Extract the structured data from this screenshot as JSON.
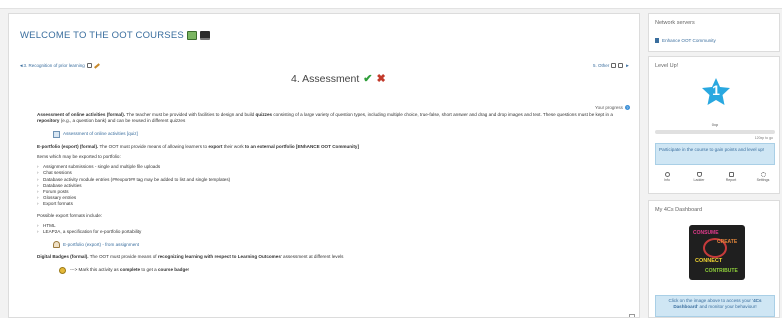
{
  "course": {
    "title": "WELCOME TO THE OOT COURSES",
    "icons": [
      "book-icon",
      "laptop-icon"
    ]
  },
  "section_nav": {
    "prev": "◄3. Recognition of prior learning",
    "next": "5. Other"
  },
  "section": {
    "title": "4. Assessment",
    "progress_label": "Your progress"
  },
  "content": {
    "p1_bold": "Assessment of online activities (formal).",
    "p1_a": " The teacher must be provided with facilities to design and build ",
    "p1_b": "quizzes",
    "p1_c": " consisting of a large variety of question types, including multiple choice, true-false, short answer and drag and drop images and text. These questions must be kept in a ",
    "p1_d": "repository",
    "p1_e": " (e.g., a question bank) and can be reused in different quizzes",
    "quiz_link": "Assessment of online activities [quiz]",
    "p2_bold": "E-portfolio (export) (formal).",
    "p2_a": " The OOT must provide means of allowing learners to ",
    "p2_b": "export",
    "p2_c": " their work ",
    "p2_d": "to an external portfolio [ENhANCE OOT Community]",
    "items_intro": "Items which may be exported to portfolio:",
    "export_items": [
      "Assignment submissions - single and multiple file uploads",
      "Chat sessions",
      "Database activity module entries (##export## tag may be added to list and single templates)",
      "Database activities",
      "Forum posts",
      "Glossary entries",
      "Export formats"
    ],
    "formats_intro": "Possible export formats include:",
    "formats": [
      "HTML",
      "LEAP2A, a specification for e-portfolio portability"
    ],
    "assign_link": "E-portfolio (export) - from assignment",
    "p3_bold": "Digital Badges (formal).",
    "p3_a": " The OOT must provide means of ",
    "p3_b": "recognizing learning with respect to Learning Outcomes",
    "p3_c": "' assessment at different levels",
    "badge_a": "---> Mark this activity as ",
    "badge_b": "complete",
    "badge_c": " to get a ",
    "badge_d": "course badge",
    "badge_e": "!"
  },
  "blocks": {
    "network": {
      "title": "Network servers",
      "item": "Enhance OOT Community"
    },
    "level": {
      "title": "Level Up!",
      "level": "1",
      "xp": "0xp",
      "progress": 0,
      "xp_needed": "120xp to go",
      "info": "Participate in the course to gain points and level up!",
      "nav": [
        {
          "label": "Info",
          "icon": "info-icon"
        },
        {
          "label": "Ladder",
          "icon": "trophy-icon"
        },
        {
          "label": "Report",
          "icon": "report-icon"
        },
        {
          "label": "Settings",
          "icon": "gear-icon"
        }
      ]
    },
    "dashboard": {
      "title": "My 4Cs Dashboard",
      "image_words": [
        "CONSUME",
        "CREATE",
        "CONNECT",
        "CONTRIBUTE"
      ],
      "note_a": "Click on the image above to access your '",
      "note_b": "4Cs Dashboard",
      "note_c": "' and monitor your behaviour!"
    }
  },
  "colors": {
    "link": "#3a6e9e",
    "check": "#2e9e3a",
    "cross": "#c23a2b",
    "star": "#29a8e0",
    "info_bg": "#cfe6f4"
  }
}
